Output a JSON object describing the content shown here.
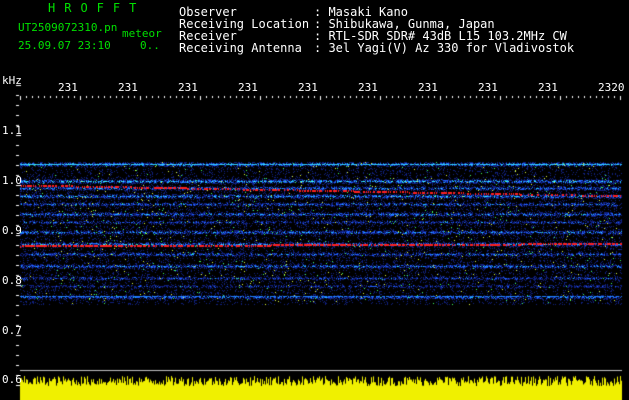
{
  "brand": "HROFFT",
  "filename": "UT2509072310.pn",
  "meteor_label": "meteor",
  "datetime": "25.09.07 23:10",
  "counter": "0..",
  "info": {
    "labels": [
      "Observer",
      "Receiving Location",
      "Receiver",
      "Receiving Antenna"
    ],
    "values": [
      ": Masaki Kano",
      ": Shibukawa, Gunma, Japan",
      ": RTL-SDR SDR# 43dB L15 103.2MHz CW",
      ": 3el Yagi(V) Az 330 for Vladivostok"
    ]
  },
  "khz_label": "kHz",
  "time_ticks": [
    "231",
    "231",
    "231",
    "231",
    "231",
    "231",
    "231",
    "231",
    "231",
    "2320"
  ],
  "freq_ticks": [
    "1.1",
    "1.0",
    "0.9",
    "0.8",
    "0.7",
    "0.6"
  ],
  "colors": {
    "background": "#000000",
    "header_green": "#00e000",
    "text": "#ffffff",
    "bottom_band": "#f0f000",
    "noise_low": "#102080",
    "noise_mid": "#2060ff",
    "signal": "#ff2020"
  }
}
